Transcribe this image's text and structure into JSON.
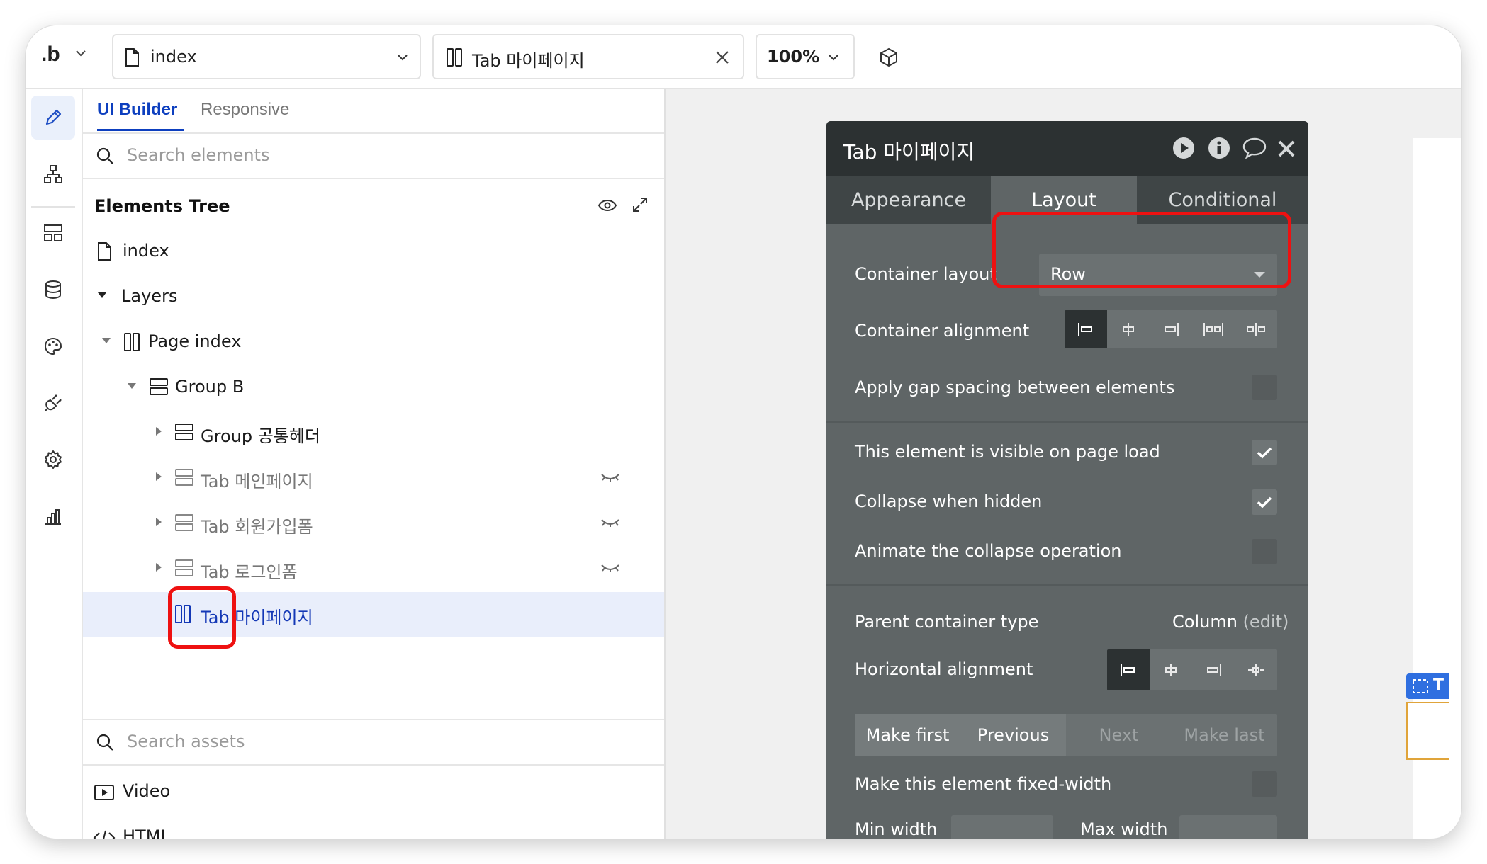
{
  "topbar": {
    "logo": ".b",
    "page_select": "index",
    "element_select": "Tab 마이페이지",
    "zoom": "100%"
  },
  "rail": {
    "icons": [
      "design-pencil-icon",
      "workflow-icon",
      "data-layout-icon",
      "database-icon",
      "styles-palette-icon",
      "plugins-icon",
      "settings-gear-icon",
      "logs-chart-icon"
    ]
  },
  "panel": {
    "tabs": [
      "UI Builder",
      "Responsive"
    ],
    "search_placeholder": "Search elements",
    "tree_title": "Elements Tree",
    "tree": [
      {
        "label": "index"
      },
      {
        "label": "Layers"
      },
      {
        "label": "Page index"
      },
      {
        "label": "Group B"
      },
      {
        "label": "Group 공통헤더"
      },
      {
        "label": "Tab 메인페이지"
      },
      {
        "label": "Tab 회원가입폼"
      },
      {
        "label": "Tab 로그인폼"
      },
      {
        "label": "Tab 마이페이지"
      }
    ],
    "assets_placeholder": "Search assets",
    "assets": [
      "Video",
      "HTML"
    ]
  },
  "canvas": {
    "tag_text": "T"
  },
  "editor": {
    "title": "Tab 마이페이지",
    "tabs": [
      "Appearance",
      "Layout",
      "Conditional"
    ],
    "active_tab": "Layout",
    "container_layout_label": "Container layout",
    "container_layout_value": "Row",
    "container_alignment_label": "Container alignment",
    "gap_label": "Apply gap spacing between elements",
    "gap_checked": false,
    "visible_label": "This element is visible on page load",
    "visible_checked": true,
    "collapse_label": "Collapse when hidden",
    "collapse_checked": true,
    "animate_label": "Animate the collapse operation",
    "animate_checked": false,
    "parent_type_label": "Parent container type",
    "parent_type_value": "Column",
    "parent_type_edit": "(edit)",
    "h_align_label": "Horizontal alignment",
    "order_buttons": [
      "Make first",
      "Previous",
      "Next",
      "Make last"
    ],
    "fixed_width_label": "Make this element fixed-width",
    "fixed_width_checked": false,
    "min_width_label": "Min width",
    "max_width_label": "Max width"
  },
  "colors": {
    "accent": "#0d3fbf",
    "highlight_red": "#ee1111",
    "editor_bg": "#5f6566",
    "editor_header": "#2c3132"
  }
}
